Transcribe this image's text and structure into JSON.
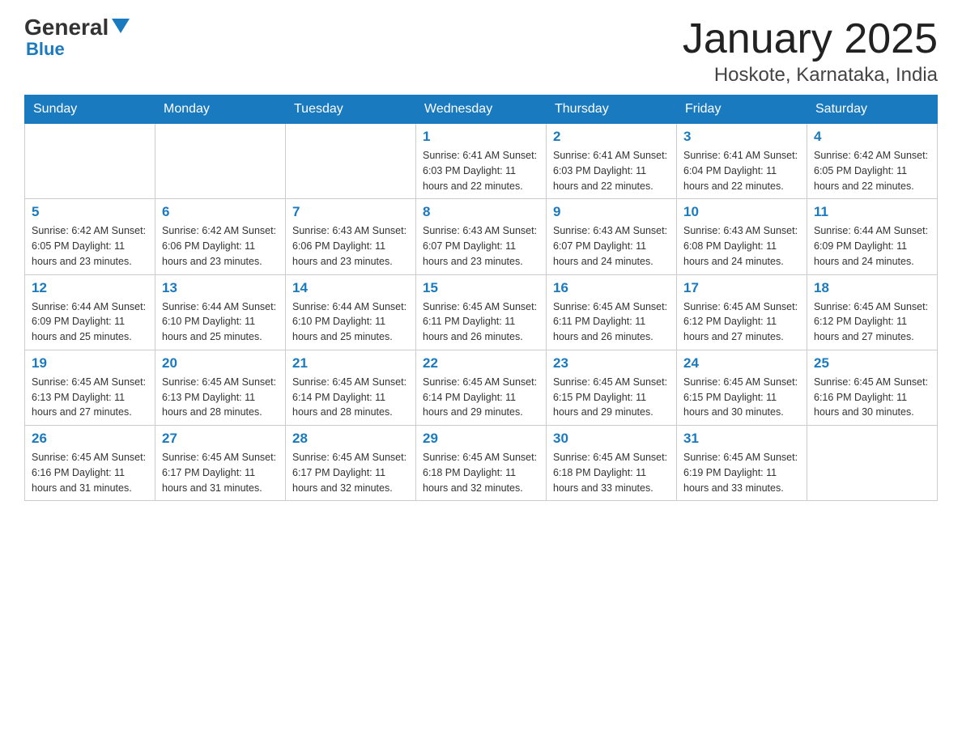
{
  "header": {
    "logo_general": "General",
    "logo_blue": "Blue",
    "month_title": "January 2025",
    "location": "Hoskote, Karnataka, India"
  },
  "days_of_week": [
    "Sunday",
    "Monday",
    "Tuesday",
    "Wednesday",
    "Thursday",
    "Friday",
    "Saturday"
  ],
  "weeks": [
    [
      {
        "day": "",
        "info": ""
      },
      {
        "day": "",
        "info": ""
      },
      {
        "day": "",
        "info": ""
      },
      {
        "day": "1",
        "info": "Sunrise: 6:41 AM\nSunset: 6:03 PM\nDaylight: 11 hours and 22 minutes."
      },
      {
        "day": "2",
        "info": "Sunrise: 6:41 AM\nSunset: 6:03 PM\nDaylight: 11 hours and 22 minutes."
      },
      {
        "day": "3",
        "info": "Sunrise: 6:41 AM\nSunset: 6:04 PM\nDaylight: 11 hours and 22 minutes."
      },
      {
        "day": "4",
        "info": "Sunrise: 6:42 AM\nSunset: 6:05 PM\nDaylight: 11 hours and 22 minutes."
      }
    ],
    [
      {
        "day": "5",
        "info": "Sunrise: 6:42 AM\nSunset: 6:05 PM\nDaylight: 11 hours and 23 minutes."
      },
      {
        "day": "6",
        "info": "Sunrise: 6:42 AM\nSunset: 6:06 PM\nDaylight: 11 hours and 23 minutes."
      },
      {
        "day": "7",
        "info": "Sunrise: 6:43 AM\nSunset: 6:06 PM\nDaylight: 11 hours and 23 minutes."
      },
      {
        "day": "8",
        "info": "Sunrise: 6:43 AM\nSunset: 6:07 PM\nDaylight: 11 hours and 23 minutes."
      },
      {
        "day": "9",
        "info": "Sunrise: 6:43 AM\nSunset: 6:07 PM\nDaylight: 11 hours and 24 minutes."
      },
      {
        "day": "10",
        "info": "Sunrise: 6:43 AM\nSunset: 6:08 PM\nDaylight: 11 hours and 24 minutes."
      },
      {
        "day": "11",
        "info": "Sunrise: 6:44 AM\nSunset: 6:09 PM\nDaylight: 11 hours and 24 minutes."
      }
    ],
    [
      {
        "day": "12",
        "info": "Sunrise: 6:44 AM\nSunset: 6:09 PM\nDaylight: 11 hours and 25 minutes."
      },
      {
        "day": "13",
        "info": "Sunrise: 6:44 AM\nSunset: 6:10 PM\nDaylight: 11 hours and 25 minutes."
      },
      {
        "day": "14",
        "info": "Sunrise: 6:44 AM\nSunset: 6:10 PM\nDaylight: 11 hours and 25 minutes."
      },
      {
        "day": "15",
        "info": "Sunrise: 6:45 AM\nSunset: 6:11 PM\nDaylight: 11 hours and 26 minutes."
      },
      {
        "day": "16",
        "info": "Sunrise: 6:45 AM\nSunset: 6:11 PM\nDaylight: 11 hours and 26 minutes."
      },
      {
        "day": "17",
        "info": "Sunrise: 6:45 AM\nSunset: 6:12 PM\nDaylight: 11 hours and 27 minutes."
      },
      {
        "day": "18",
        "info": "Sunrise: 6:45 AM\nSunset: 6:12 PM\nDaylight: 11 hours and 27 minutes."
      }
    ],
    [
      {
        "day": "19",
        "info": "Sunrise: 6:45 AM\nSunset: 6:13 PM\nDaylight: 11 hours and 27 minutes."
      },
      {
        "day": "20",
        "info": "Sunrise: 6:45 AM\nSunset: 6:13 PM\nDaylight: 11 hours and 28 minutes."
      },
      {
        "day": "21",
        "info": "Sunrise: 6:45 AM\nSunset: 6:14 PM\nDaylight: 11 hours and 28 minutes."
      },
      {
        "day": "22",
        "info": "Sunrise: 6:45 AM\nSunset: 6:14 PM\nDaylight: 11 hours and 29 minutes."
      },
      {
        "day": "23",
        "info": "Sunrise: 6:45 AM\nSunset: 6:15 PM\nDaylight: 11 hours and 29 minutes."
      },
      {
        "day": "24",
        "info": "Sunrise: 6:45 AM\nSunset: 6:15 PM\nDaylight: 11 hours and 30 minutes."
      },
      {
        "day": "25",
        "info": "Sunrise: 6:45 AM\nSunset: 6:16 PM\nDaylight: 11 hours and 30 minutes."
      }
    ],
    [
      {
        "day": "26",
        "info": "Sunrise: 6:45 AM\nSunset: 6:16 PM\nDaylight: 11 hours and 31 minutes."
      },
      {
        "day": "27",
        "info": "Sunrise: 6:45 AM\nSunset: 6:17 PM\nDaylight: 11 hours and 31 minutes."
      },
      {
        "day": "28",
        "info": "Sunrise: 6:45 AM\nSunset: 6:17 PM\nDaylight: 11 hours and 32 minutes."
      },
      {
        "day": "29",
        "info": "Sunrise: 6:45 AM\nSunset: 6:18 PM\nDaylight: 11 hours and 32 minutes."
      },
      {
        "day": "30",
        "info": "Sunrise: 6:45 AM\nSunset: 6:18 PM\nDaylight: 11 hours and 33 minutes."
      },
      {
        "day": "31",
        "info": "Sunrise: 6:45 AM\nSunset: 6:19 PM\nDaylight: 11 hours and 33 minutes."
      },
      {
        "day": "",
        "info": ""
      }
    ]
  ]
}
